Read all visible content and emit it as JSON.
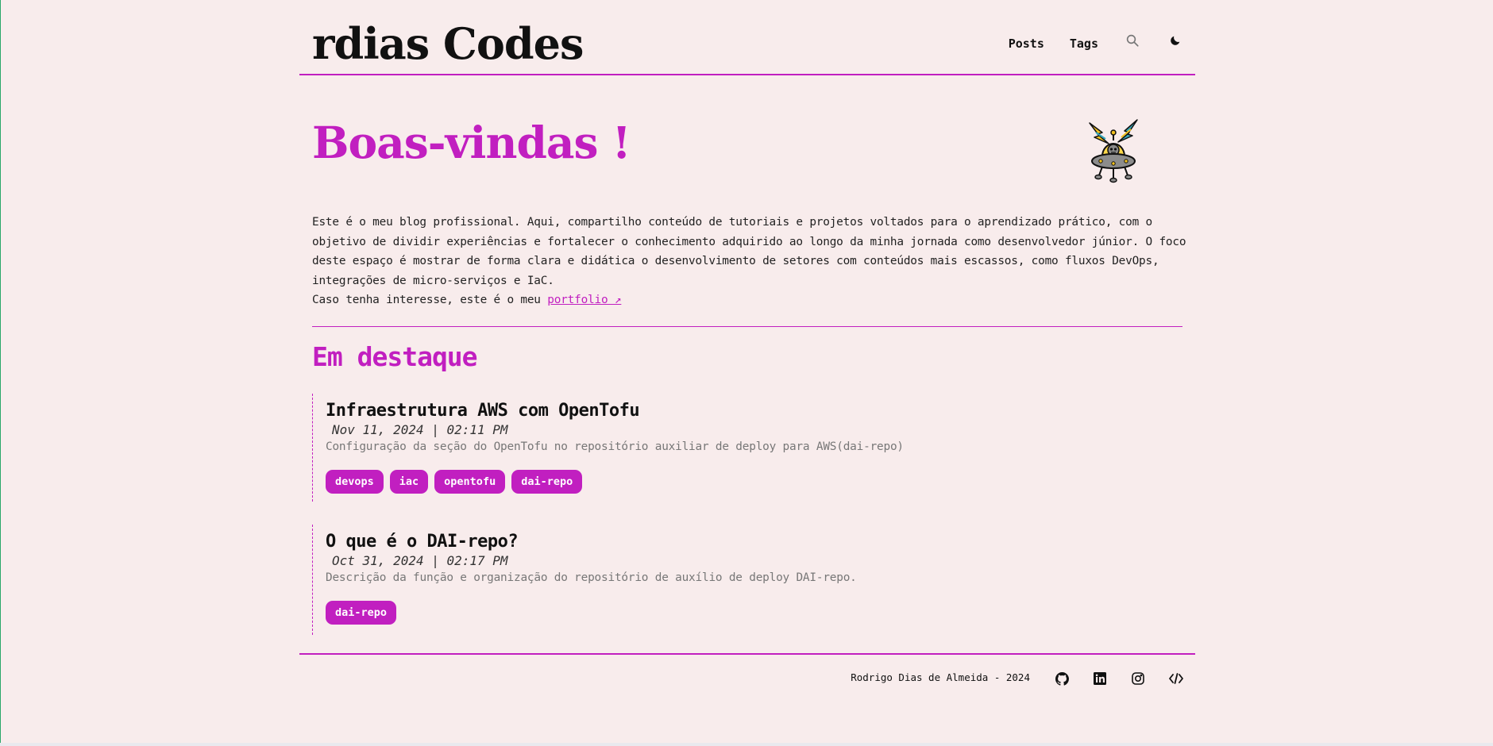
{
  "site": {
    "title": "rdias Codes"
  },
  "nav": {
    "posts_label": "Posts",
    "tags_label": "Tags",
    "search_icon": "search-icon",
    "theme_icon": "moon-icon"
  },
  "hero": {
    "title": "Boas-vindas !",
    "mascot": "ufo-robot-mascot",
    "intro_text": "Este é o meu blog profissional. Aqui, compartilho conteúdo de tutoriais e projetos voltados para o aprendizado prático, com o objetivo de dividir experiências e fortalecer o conhecimento adquirido ao longo da minha jornada como desenvolvedor júnior. O foco deste espaço é mostrar de forma clara e didática o desenvolvimento de setores com conteúdos mais escassos, como fluxos DevOps, integrações de micro-serviços e IaC.",
    "portfolio_prefix": "Caso tenha interesse, este é o meu ",
    "portfolio_link": "portfolio ↗"
  },
  "featured": {
    "title": "Em destaque",
    "posts": [
      {
        "title": "Infraestrutura AWS com OpenTofu",
        "date": "Nov 11, 2024 | 02:11 PM",
        "description": "Configuração da seção do OpenTofu no repositório auxiliar de deploy para AWS(dai-repo)",
        "tags": [
          "devops",
          "iac",
          "opentofu",
          "dai-repo"
        ]
      },
      {
        "title": "O que é o DAI-repo?",
        "date": "Oct 31, 2024 | 02:17 PM",
        "description": "Descrição da função e organização do repositório de auxílio de deploy DAI-repo.",
        "tags": [
          "dai-repo"
        ]
      }
    ]
  },
  "footer": {
    "copyright": "Rodrigo Dias de Almeida - 2024",
    "socials": [
      "github-icon",
      "linkedin-icon",
      "instagram-icon",
      "code-icon"
    ]
  },
  "colors": {
    "accent": "#c11fc0",
    "background": "#f8ecec",
    "text": "#111111",
    "muted": "#777777"
  }
}
